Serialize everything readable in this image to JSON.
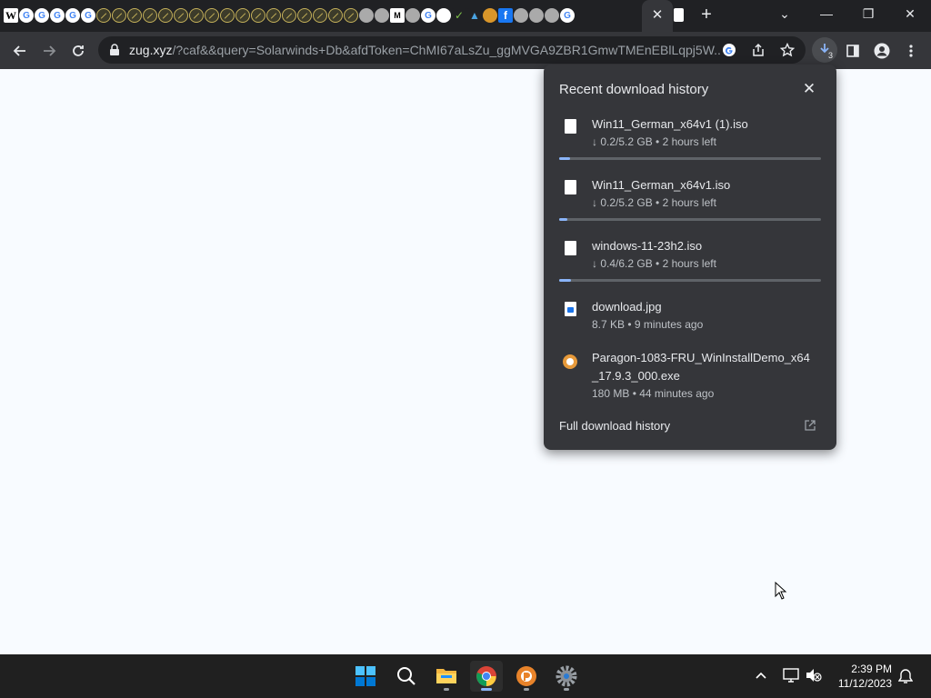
{
  "tabstrip": {
    "favicons": [
      "wikipedia-icon",
      "google-icon",
      "google-icon",
      "google-icon",
      "google-icon",
      "google-icon",
      "blocked-icon",
      "blocked-icon",
      "blocked-icon",
      "blocked-icon",
      "blocked-icon",
      "blocked-icon",
      "blocked-icon",
      "blocked-icon",
      "blocked-icon",
      "blocked-icon",
      "blocked-icon",
      "blocked-icon",
      "blocked-icon",
      "blocked-icon",
      "blocked-icon",
      "blocked-icon",
      "blocked-icon",
      "gray-site-icon",
      "gray-site-icon",
      "medium-icon",
      "gray-site-icon",
      "google-icon",
      "snapchat-icon",
      "arrow-site-icon",
      "tv-site-icon",
      "postman-icon",
      "facebook-icon",
      "gray-site-icon",
      "gray-site-icon",
      "gray-site-icon",
      "google-icon"
    ],
    "close_glyph": "✕",
    "new_tab_glyph": "+"
  },
  "window_controls": {
    "tab_search": "⌄",
    "minimize": "—",
    "maximize": "❐",
    "close": "✕"
  },
  "toolbar": {
    "url_host": "zug.xyz",
    "url_rest": "/?caf&&query=Solarwinds+Db&afdToken=ChMI67aLsZu_ggMVGA9ZBR1GmwTMEnEBlLqpj5W...",
    "download_count": "3"
  },
  "downloads": {
    "title": "Recent download history",
    "items": [
      {
        "name": "Win11_German_x64v1 (1).iso",
        "status": "↓ 0.2/5.2 GB • 2 hours left",
        "kind": "file-icon",
        "progress": 0.04
      },
      {
        "name": "Win11_German_x64v1.iso",
        "status": "↓ 0.2/5.2 GB • 2 hours left",
        "kind": "file-icon",
        "progress": 0.03
      },
      {
        "name": "windows-11-23h2.iso",
        "status": "↓ 0.4/6.2 GB • 2 hours left",
        "kind": "file-icon",
        "progress": 0.045
      },
      {
        "name": "download.jpg",
        "status": "8.7 KB • 9 minutes ago",
        "kind": "image-file-icon"
      },
      {
        "name": "Paragon-1083-FRU_WinInstallDemo_x64_17.9.3_000.exe",
        "status": "180 MB • 44 minutes ago",
        "kind": "paragon-app-icon"
      }
    ],
    "full_history": "Full download history"
  },
  "taskbar": {
    "apps": [
      "start-icon",
      "search-icon",
      "file-explorer-icon",
      "chrome-icon",
      "paragon-icon",
      "settings-icon"
    ],
    "time": "2:39 PM",
    "date": "11/12/2023"
  },
  "colors": {
    "accent": "#8ab4f8",
    "popup_bg": "#35363a",
    "page_bg": "#f8fbff"
  }
}
